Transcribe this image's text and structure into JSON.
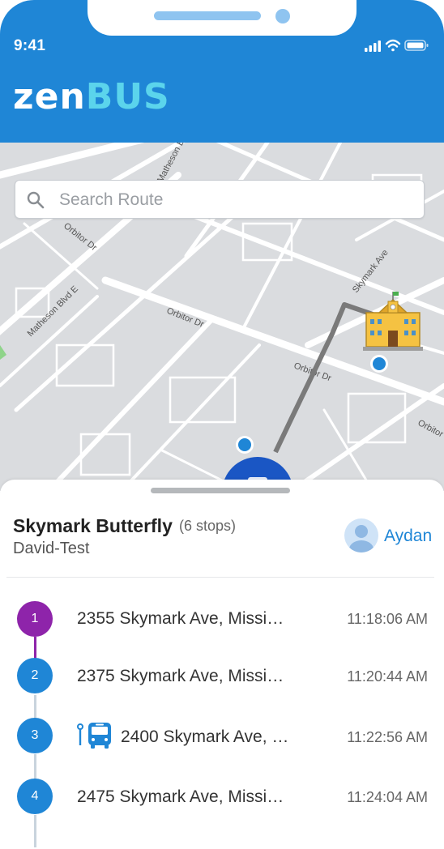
{
  "status_bar": {
    "time": "9:41"
  },
  "app": {
    "logo_part1": "zen",
    "logo_part2": "BUS"
  },
  "map": {
    "street_labels": [
      "Matheson Bl",
      "Orbitor Dr",
      "Matheson Blvd E",
      "Orbitor Dr",
      "Skymark Ave",
      "Orbitor Dr",
      "Orbitor"
    ]
  },
  "search": {
    "placeholder": "Search Route",
    "icon": "search-icon"
  },
  "route": {
    "name": "Skymark Butterfly",
    "stops_count": "(6 stops)",
    "subtitle": "David-Test",
    "user": "Aydan"
  },
  "stops": [
    {
      "number": "1",
      "address": "2355 Skymark Ave, Missi…",
      "time": "11:18:06 AM",
      "color": "#8e24aa"
    },
    {
      "number": "2",
      "address": "2375 Skymark Ave, Missi…",
      "time": "11:20:44 AM",
      "color": "#1f86d6"
    },
    {
      "number": "3",
      "address": "2400 Skymark Ave, …",
      "time": "11:22:56 AM",
      "color": "#1f86d6"
    },
    {
      "number": "4",
      "address": "2475 Skymark Ave, Missi…",
      "time": "11:24:04 AM",
      "color": "#1f86d6"
    }
  ],
  "colors": {
    "brand": "#1f86d6",
    "accent": "#5bd4ec",
    "completed": "#8e24aa"
  }
}
